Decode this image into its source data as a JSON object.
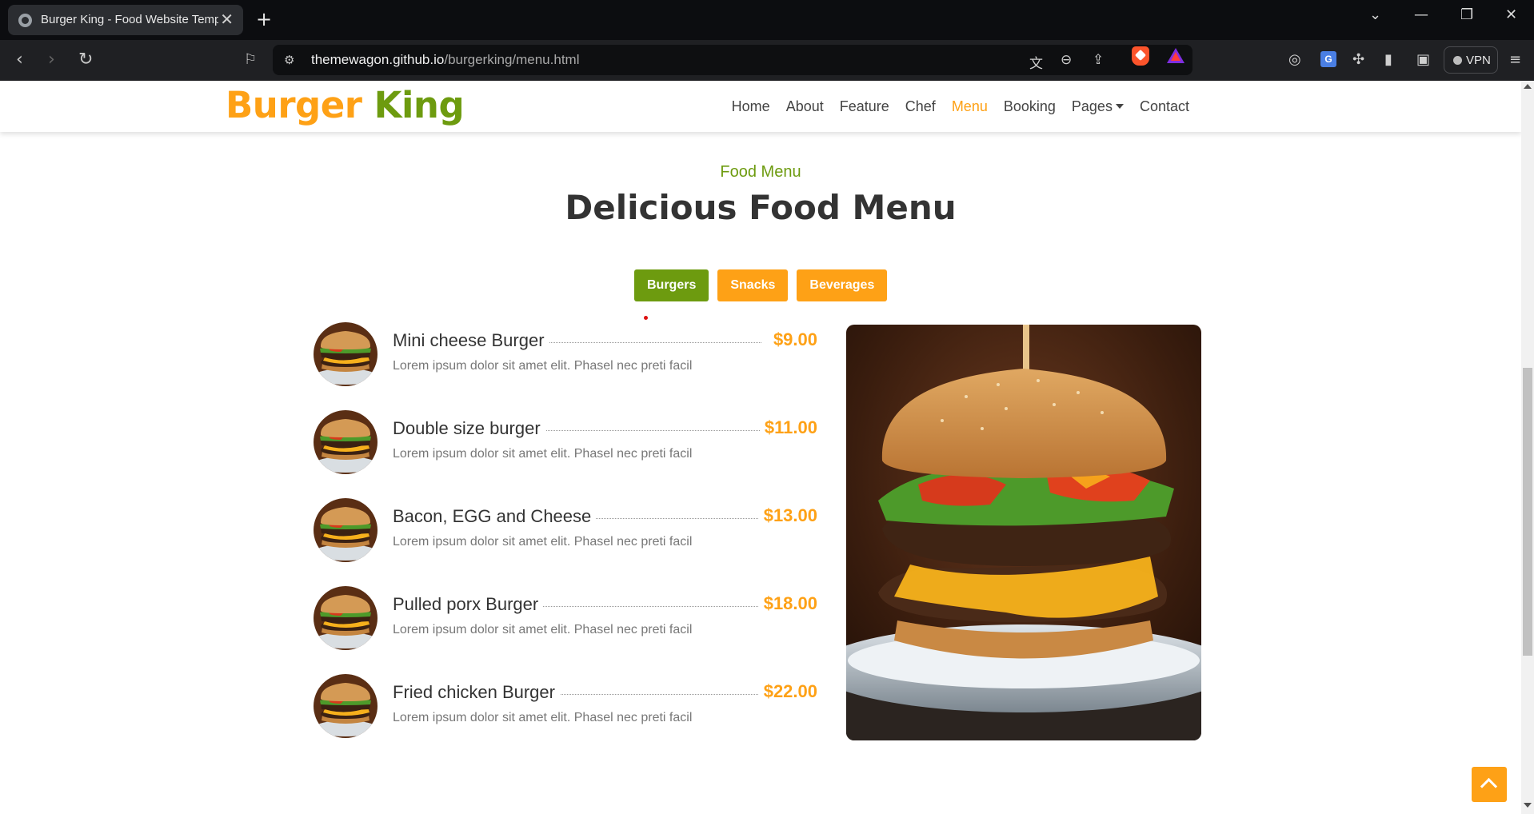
{
  "browser": {
    "tab_title": "Burger King - Food Website Template",
    "tab_close": "✕",
    "new_tab": "+",
    "url_host": "themewagon.github.io",
    "url_path": "/burgerking/menu.html",
    "vpn_label": "VPN"
  },
  "site": {
    "brand_part1": "Burger",
    "brand_part2": "King",
    "nav": {
      "home": "Home",
      "about": "About",
      "feature": "Feature",
      "chef": "Chef",
      "menu": "Menu",
      "booking": "Booking",
      "pages": "Pages",
      "contact": "Contact"
    },
    "accent_orange": "#fea116",
    "accent_green": "#6d9b0f"
  },
  "section": {
    "subtitle": "Food Menu",
    "title": "Delicious Food Menu"
  },
  "tabs": {
    "burgers": "Burgers",
    "snacks": "Snacks",
    "beverages": "Beverages",
    "active": "Burgers"
  },
  "items": [
    {
      "name": "Mini cheese Burger",
      "price": "$9.00",
      "desc": "Lorem ipsum dolor sit amet elit. Phasel nec preti facil"
    },
    {
      "name": "Double size burger",
      "price": "$11.00",
      "desc": "Lorem ipsum dolor sit amet elit. Phasel nec preti facil"
    },
    {
      "name": "Bacon, EGG and Cheese",
      "price": "$13.00",
      "desc": "Lorem ipsum dolor sit amet elit. Phasel nec preti facil"
    },
    {
      "name": "Pulled porx Burger",
      "price": "$18.00",
      "desc": "Lorem ipsum dolor sit amet elit. Phasel nec preti facil"
    },
    {
      "name": "Fried chicken Burger",
      "price": "$22.00",
      "desc": "Lorem ipsum dolor sit amet elit. Phasel nec preti facil"
    }
  ]
}
